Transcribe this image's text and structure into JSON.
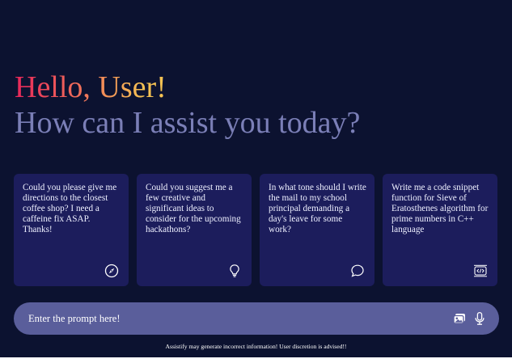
{
  "greeting": {
    "hello": "Hello, User!",
    "subtitle": "How can I assist you today?"
  },
  "cards": [
    {
      "text": "Could you please give me directions to the closest coffee shop? I need a caffeine fix ASAP. Thanks!",
      "icon": "compass-icon"
    },
    {
      "text": "Could you suggest me a few creative and significant ideas to consider for the upcoming hackathons?",
      "icon": "lightbulb-icon"
    },
    {
      "text": "In what tone should I write the mail to my school principal demanding a day's leave for some work?",
      "icon": "chat-bubble-icon"
    },
    {
      "text": "Write me a code snippet function for Sieve of Eratosthenes algorithm for prime numbers in C++ language",
      "icon": "code-icon"
    }
  ],
  "prompt": {
    "placeholder": "Enter the prompt here!",
    "value": "",
    "icons": [
      "gallery-icon",
      "microphone-icon"
    ]
  },
  "disclaimer": "Assistify may generate incorrect information! User discretion is advised!!",
  "colors": {
    "background": "#0c1230",
    "card": "#1c1d5c",
    "prompt_bar": "#5a5e9b",
    "subtitle": "#7b7fb7",
    "gradient_start": "#e8265a",
    "gradient_mid": "#f0735a",
    "gradient_end": "#f5c253"
  }
}
